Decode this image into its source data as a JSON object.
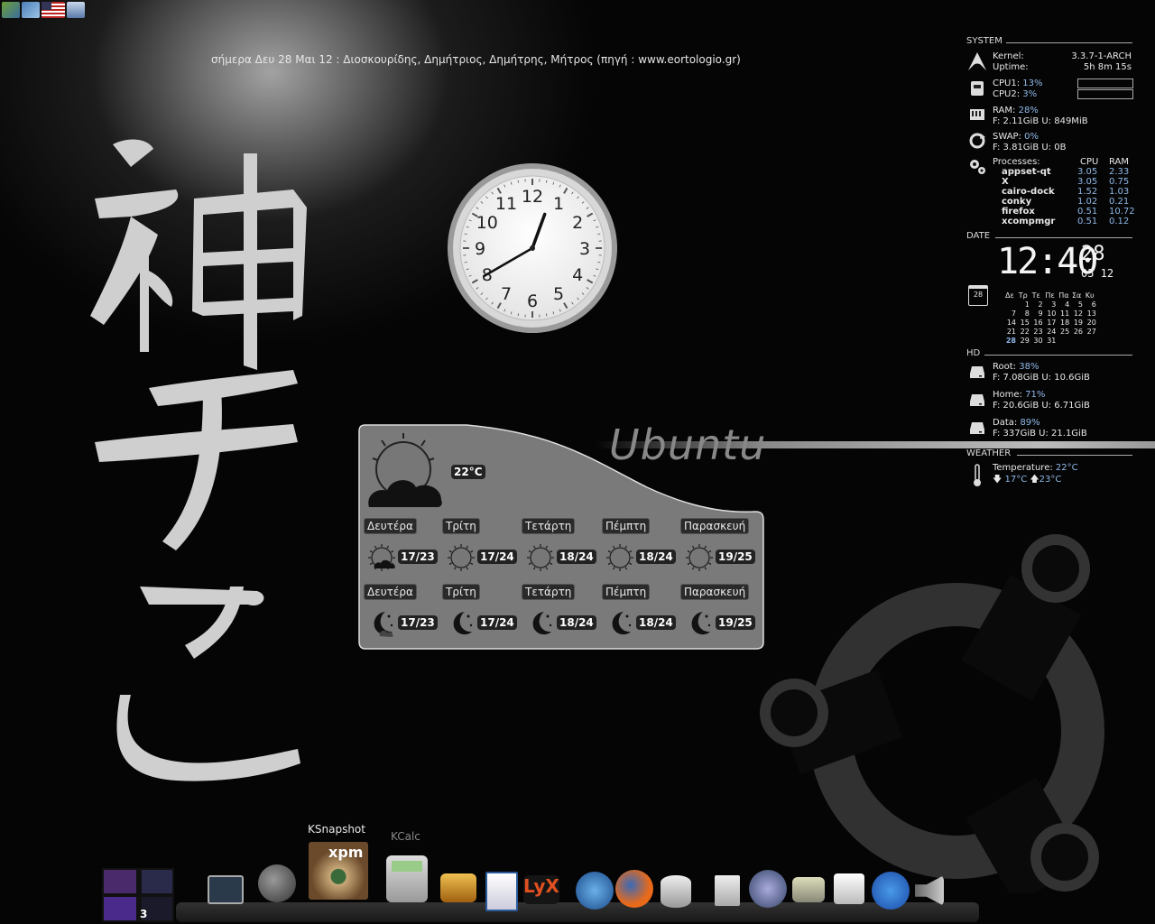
{
  "nameday_text": "σήμερα Δευ 28 Μαι 12 : Διοσκουρίδης, Δημήτριος, Δημήτρης, Μήτρος (πηγή : www.eortologio.gr)",
  "wallpaper": {
    "word": "Ubuntu"
  },
  "clock": {
    "numbers": [
      "12",
      "1",
      "2",
      "3",
      "4",
      "5",
      "6",
      "7",
      "8",
      "9",
      "10",
      "11"
    ],
    "hour": 12,
    "minute": 40
  },
  "weather": {
    "current_temp": "22°C",
    "day_row": [
      {
        "day": "Δευτέρα",
        "temps": "17/23",
        "icon": "partly-cloudy-icon"
      },
      {
        "day": "Τρίτη",
        "temps": "17/24",
        "icon": "sun-icon"
      },
      {
        "day": "Τετάρτη",
        "temps": "18/24",
        "icon": "sun-icon"
      },
      {
        "day": "Πέμπτη",
        "temps": "18/24",
        "icon": "sun-icon"
      },
      {
        "day": "Παρασκευή",
        "temps": "19/25",
        "icon": "sun-icon"
      }
    ],
    "night_row": [
      {
        "day": "Δευτέρα",
        "temps": "17/23",
        "icon": "moon-cloud-icon"
      },
      {
        "day": "Τρίτη",
        "temps": "17/24",
        "icon": "moon-icon"
      },
      {
        "day": "Τετάρτη",
        "temps": "18/24",
        "icon": "moon-icon"
      },
      {
        "day": "Πέμπτη",
        "temps": "18/24",
        "icon": "moon-icon"
      },
      {
        "day": "Παρασκευή",
        "temps": "19/25",
        "icon": "moon-icon"
      }
    ]
  },
  "conky": {
    "system_title": "SYSTEM",
    "kernel_label": "Kernel:",
    "kernel_value": "3.3.7-1-ARCH",
    "uptime_label": "Uptime:",
    "uptime_value": "5h 8m 15s",
    "cpu1_label": "CPU1:",
    "cpu1_value": "13%",
    "cpu2_label": "CPU2:",
    "cpu2_value": "3%",
    "ram_label": "RAM:",
    "ram_value": "28%",
    "ram_detail": "F: 2.11GiB U: 849MiB",
    "swap_label": "SWAP:",
    "swap_value": "0%",
    "swap_detail": "F: 3.81GiB U: 0B",
    "processes_label": "Processes:",
    "cpu_col": "CPU",
    "ram_col": "RAM",
    "processes": [
      {
        "name": "appset-qt",
        "cpu": "3.05",
        "ram": "2.33"
      },
      {
        "name": "X",
        "cpu": "3.05",
        "ram": "0.75"
      },
      {
        "name": "cairo-dock",
        "cpu": "1.52",
        "ram": "1.03"
      },
      {
        "name": "conky",
        "cpu": "1.02",
        "ram": "0.21"
      },
      {
        "name": "firefox",
        "cpu": "0.51",
        "ram": "10.72"
      },
      {
        "name": "xcompmgr",
        "cpu": "0.51",
        "ram": "0.12"
      }
    ],
    "date_title": "DATE",
    "time": "12:40",
    "day": "28",
    "month": "05 12",
    "cal_icon_day": "28",
    "cal_header": [
      "Δε",
      "Τρ",
      "Τε",
      "Πε",
      "Πα",
      "Σα",
      "Κυ"
    ],
    "cal_weeks": [
      [
        "",
        "1",
        "2",
        "3",
        "4",
        "5",
        "6"
      ],
      [
        "7",
        "8",
        "9",
        "10",
        "11",
        "12",
        "13"
      ],
      [
        "14",
        "15",
        "16",
        "17",
        "18",
        "19",
        "20"
      ],
      [
        "21",
        "22",
        "23",
        "24",
        "25",
        "26",
        "27"
      ],
      [
        "28",
        "29",
        "30",
        "31",
        "",
        "",
        ""
      ]
    ],
    "today": "28",
    "hd_title": "HD",
    "root_label": "Root:",
    "root_value": "38%",
    "root_detail": "F: 7.08GiB U: 10.6GiB",
    "home_label": "Home:",
    "home_value": "71%",
    "home_detail": "F: 20.6GiB U: 6.71GiB",
    "data_label": "Data:",
    "data_value": "89%",
    "data_detail": "F: 337GiB U: 21.1GiB",
    "weather_title": "WEATHER",
    "temp_label": "Temperature:",
    "temp_value": "22°C",
    "temp_low": "17°C",
    "temp_high": "23°C"
  },
  "dock": {
    "ksnapshot_label": "KSnapshot",
    "kcalc_label": "KCalc",
    "workspace_count": "3"
  },
  "colors": {
    "accent_blue": "#8fb8e8",
    "weather_panel": "#7a7a7a"
  }
}
